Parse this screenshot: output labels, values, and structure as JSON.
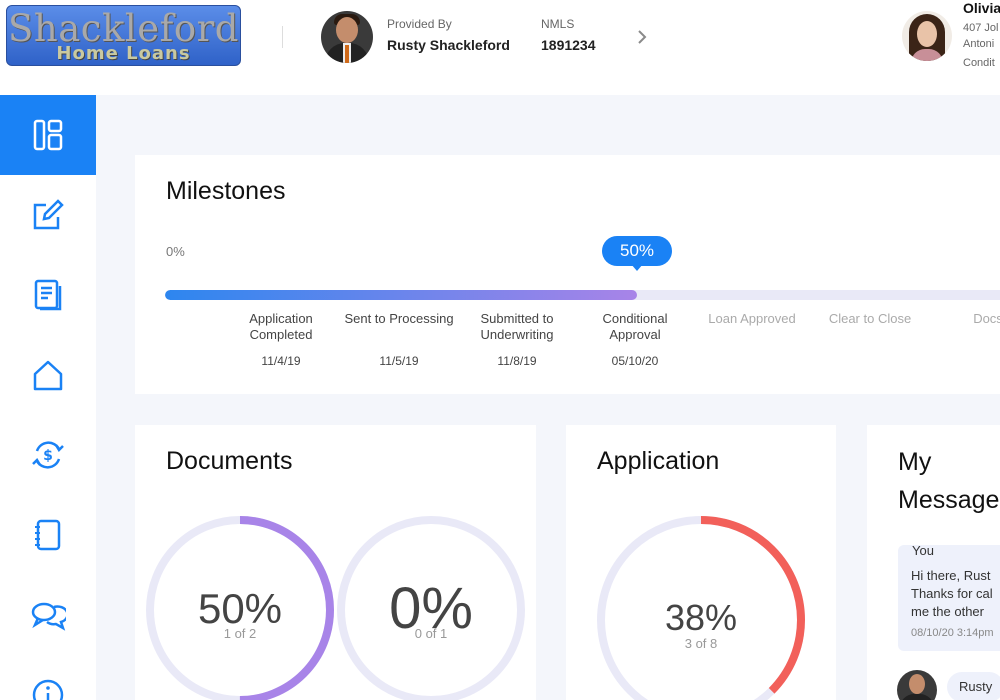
{
  "header": {
    "logo_line1": "Shackleford",
    "logo_line2": "Home Loans",
    "provided_by_label": "Provided By",
    "officer_name": "Rusty Shackleford",
    "nmls_label": "NMLS",
    "nmls_number": "1891234",
    "borrower_name": "Olivia",
    "borrower_line1": "407 Jol",
    "borrower_line2": "Antoni",
    "borrower_line3": "Condit"
  },
  "sidebar": {
    "items": [
      {
        "icon": "dashboard-icon",
        "active": true
      },
      {
        "icon": "edit-icon",
        "active": false
      },
      {
        "icon": "documents-icon",
        "active": false
      },
      {
        "icon": "home-icon",
        "active": false
      },
      {
        "icon": "refinance-icon",
        "active": false
      },
      {
        "icon": "notebook-icon",
        "active": false
      },
      {
        "icon": "messages-icon",
        "active": false
      },
      {
        "icon": "info-icon",
        "active": false
      }
    ]
  },
  "milestones": {
    "title": "Milestones",
    "start_label": "0%",
    "progress_label": "50%",
    "progress_fraction": 0.5,
    "steps": [
      {
        "label": "Application Completed",
        "date": "11/4/19",
        "done": true
      },
      {
        "label": "Sent to Processing",
        "date": "11/5/19",
        "done": true
      },
      {
        "label": "Submitted to Underwriting",
        "date": "11/8/19",
        "done": true
      },
      {
        "label": "Conditional Approval",
        "date": "05/10/20",
        "done": true
      },
      {
        "label": "Loan Approved",
        "date": "",
        "done": false
      },
      {
        "label": "Clear to Close",
        "date": "",
        "done": false
      },
      {
        "label": "Docs",
        "date": "",
        "done": false
      }
    ]
  },
  "documents": {
    "title": "Documents",
    "rings": [
      {
        "percent": "50%",
        "fraction": 0.5,
        "sub": "1 of 2",
        "color": "#a884e8"
      },
      {
        "percent": "0%",
        "fraction": 0,
        "sub": "0 of 1",
        "color": "#a884e8"
      }
    ]
  },
  "application": {
    "title": "Application",
    "percent": "38%",
    "fraction": 0.375,
    "sub": "3 of 8",
    "color": "#f2605a"
  },
  "messages": {
    "title_line1": "My",
    "title_line2": "Message",
    "from": "You",
    "body_line1": "Hi there, Rust",
    "body_line2": "Thanks for cal",
    "body_line3": "me the other",
    "time": "08/10/20 3:14pm",
    "sender": "Rusty"
  },
  "colors": {
    "accent": "#1a82f5",
    "ring_track": "#e9e9f7"
  }
}
